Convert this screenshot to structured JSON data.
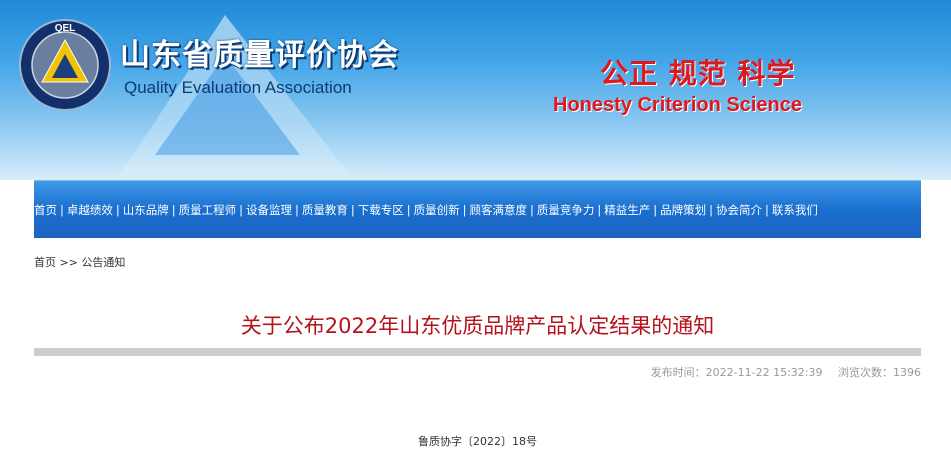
{
  "header": {
    "logo_text": "QEL",
    "logo_ring_text": "Quality Evaluation Laboratory",
    "org_name_cn": "山东省质量评价协会",
    "org_name_en": "Quality Evaluation Association",
    "slogan_cn": "公正 规范 科学",
    "slogan_en": "Honesty Criterion Science"
  },
  "nav": {
    "separator": "|",
    "items": [
      "首页",
      "卓越绩效",
      "山东品牌",
      "质量工程师",
      "设备监理",
      "质量教育",
      "下载专区",
      "质量创新",
      "顾客满意度",
      "质量竞争力",
      "精益生产",
      "品牌策划",
      "协会简介",
      "联系我们"
    ]
  },
  "breadcrumb": {
    "home": "首页",
    "separator": ">>",
    "current": "公告通知"
  },
  "article": {
    "title": "关于公布2022年山东优质品牌产品认定结果的通知",
    "publish_time": "发布时间：2022-11-22 15:32:39",
    "views": "浏览次数：1396",
    "doc_number": "鲁质协字〔2022〕18号"
  },
  "colors": {
    "nav_blue": "#1a6fcf",
    "title_red": "#b5121b",
    "slogan_red": "#e3161c"
  }
}
